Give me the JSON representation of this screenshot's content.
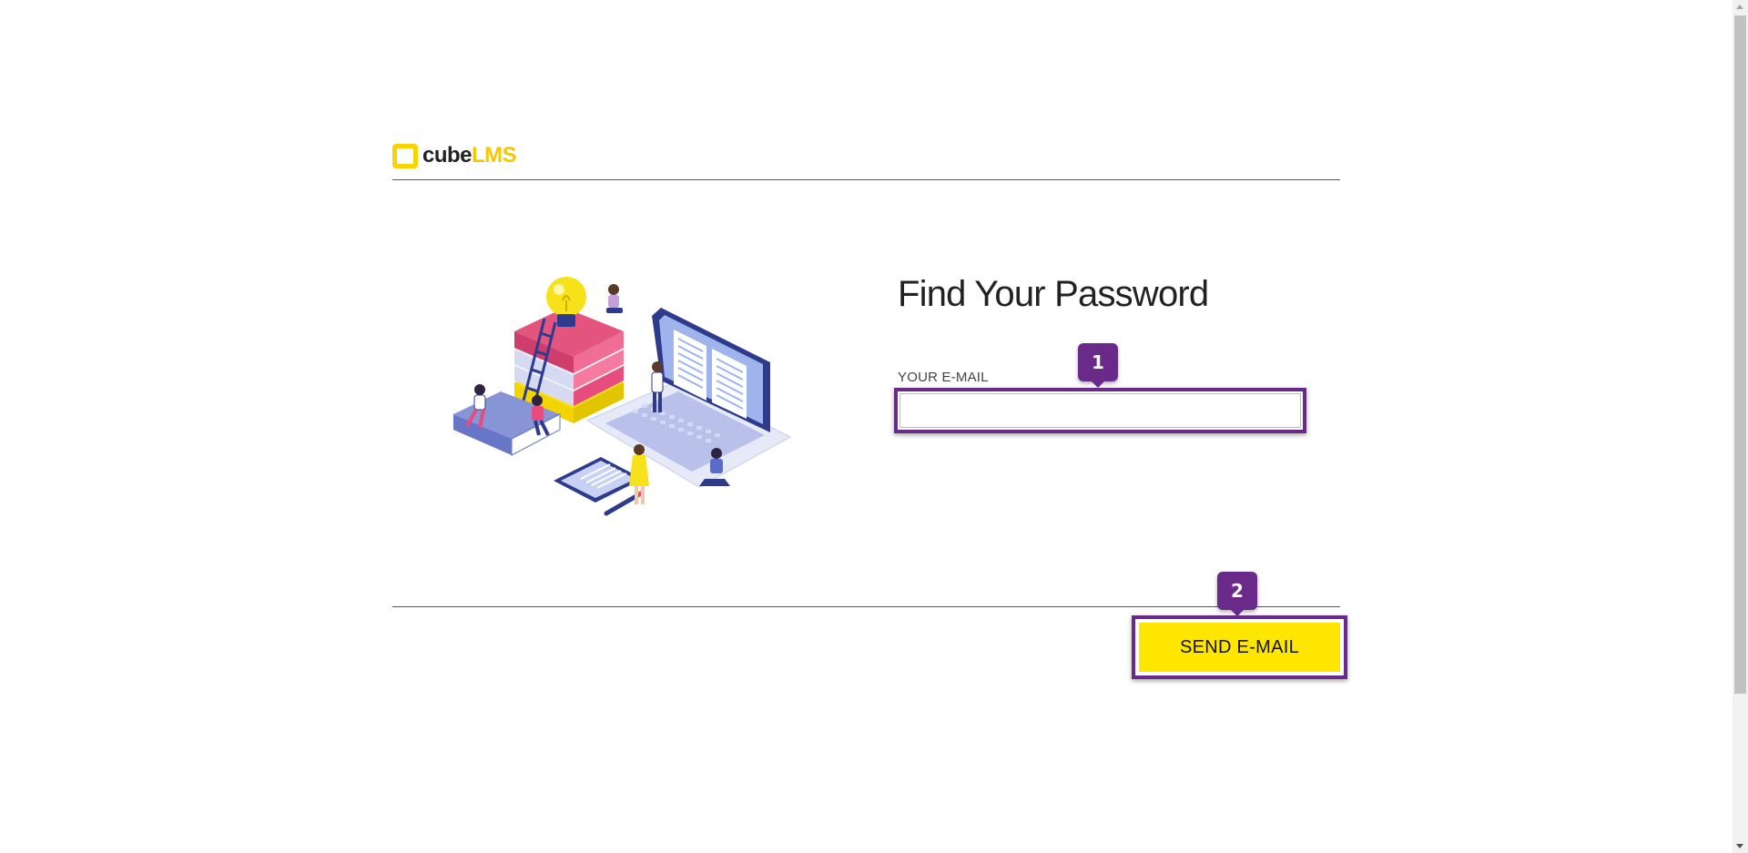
{
  "brand": {
    "logo_part1": "cube",
    "logo_part2": "LMS",
    "accent_color": "#f9d400"
  },
  "main": {
    "title": "Find Your Password",
    "email_label": "YOUR E-MAIL",
    "email_value": "",
    "send_label": "SEND E-MAIL"
  },
  "annotations": {
    "badge_1": "1",
    "badge_2": "2",
    "highlight_color": "#6a2a8a"
  },
  "illustration": {
    "icon": "online-learning-illustration"
  }
}
